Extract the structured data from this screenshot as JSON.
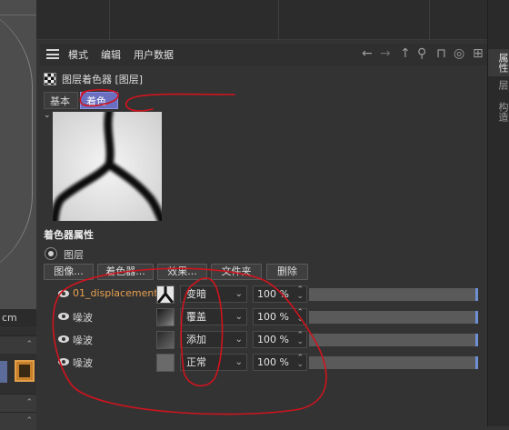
{
  "viewport": {
    "unit": "cm"
  },
  "menubar": {
    "items": [
      {
        "label": "模式"
      },
      {
        "label": "编辑"
      },
      {
        "label": "用户数据"
      }
    ],
    "icons": [
      "arrow-left-icon",
      "arrow-right-icon",
      "arrow-up-icon",
      "search-icon",
      "lock-icon",
      "target-icon",
      "add-icon"
    ]
  },
  "side_tabs": [
    "属性",
    "层",
    "构造"
  ],
  "header": {
    "title": "图层着色器 [图层]"
  },
  "tabs": [
    {
      "label": "基本"
    },
    {
      "label": "着色器"
    }
  ],
  "attributes": {
    "title": "着色器属性",
    "radio_label": "图层",
    "buttons": [
      {
        "label": "图像..."
      },
      {
        "label": "着色器..."
      },
      {
        "label": "效果..."
      },
      {
        "label": "文件夹"
      },
      {
        "label": "删除"
      }
    ]
  },
  "layers": [
    {
      "name": "01_displacement",
      "mode": "变暗",
      "opacity": "100 %",
      "name_color": "#e8a050"
    },
    {
      "name": "噪波",
      "mode": "覆盖",
      "opacity": "100 %",
      "name_color": "#d8d8d8"
    },
    {
      "name": "噪波",
      "mode": "添加",
      "opacity": "100 %",
      "name_color": "#d8d8d8"
    },
    {
      "name": "噪波",
      "mode": "正常",
      "opacity": "100 %",
      "name_color": "#d8d8d8"
    }
  ],
  "colors": {
    "active_tab": "#6b6fbf",
    "annotation": "#d0141e",
    "slider_accent": "#6f8fd4"
  }
}
